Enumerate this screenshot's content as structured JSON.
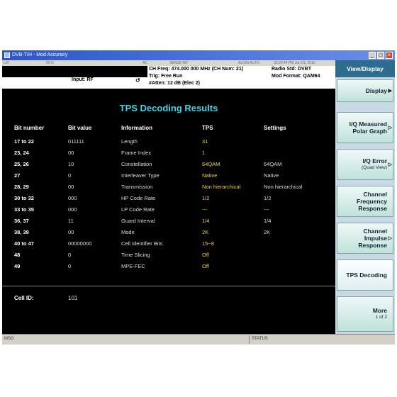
{
  "window": {
    "title": "DVB-T/H - Mod Accuracy"
  },
  "status_strip": {
    "items": [
      "LXI",
      "50 Ω",
      "AC",
      "SENSE:INT",
      "ALIGN AUTO",
      "03:26:44 PM Jun 01, 2010"
    ]
  },
  "info": {
    "input": "Input: RF",
    "ch_freq": "CH Freq: 474.000 000 MHz (CH Num: 21)",
    "trig": "Trig: Free Run",
    "atten": "#Atten: 12 dB (Elec 2)",
    "radio_std": "Radio Std: DVBT",
    "mod_format": "Mod Format: QAM64"
  },
  "panel": {
    "title": "TPS Decoding Results",
    "headers": [
      "Bit number",
      "Bit value",
      "Information",
      "TPS",
      "Settings"
    ],
    "rows": [
      [
        "17 to 22",
        "011111",
        "Length",
        "31",
        ""
      ],
      [
        "23, 24",
        "00",
        "Frame Index",
        "1",
        ""
      ],
      [
        "25, 26",
        "10",
        "Constellation",
        "64QAM",
        "64QAM"
      ],
      [
        "27",
        "0",
        "Interleaver Type",
        "Native",
        "Native"
      ],
      [
        "28, 29",
        "00",
        "Transmission",
        "Non hierarchical",
        "Non hierarchical"
      ],
      [
        "30 to 32",
        "000",
        "HP Code Rate",
        "1/2",
        "1/2"
      ],
      [
        "33 to 35",
        "000",
        "LP Code Rate",
        "---",
        "---"
      ],
      [
        "36, 37",
        "11",
        "Guard Interval",
        "1/4",
        "1/4"
      ],
      [
        "38, 39",
        "00",
        "Mode",
        "2K",
        "2K"
      ],
      [
        "40 to 47",
        "00000000",
        "Cell Identifier Bits",
        "15~8",
        ""
      ],
      [
        "48",
        "0",
        "Time Slicing",
        "Off",
        ""
      ],
      [
        "49",
        "0",
        "MPE-FEC",
        "Off",
        ""
      ]
    ],
    "cell_id_label": "Cell ID:",
    "cell_id_value": "101"
  },
  "messages": {
    "msg": "MSG",
    "status": "STATUS"
  },
  "softkeys": {
    "header": "View/Display",
    "items": [
      {
        "label": "Display",
        "arrow": "▶"
      },
      {
        "label": "I/Q Measured\nPolar Graph",
        "arrow": "▷"
      },
      {
        "label": "I/Q Error",
        "sub": "(Quad View)",
        "arrow": "▷"
      },
      {
        "label": "Channel\nFrequency\nResponse",
        "arrow": ""
      },
      {
        "label": "Channel\nImpulse\nResponse",
        "arrow": "▷"
      },
      {
        "label": "TPS Decoding",
        "arrow": ""
      },
      {
        "label": "More",
        "sub": "1 of 2",
        "arrow": ""
      }
    ]
  }
}
